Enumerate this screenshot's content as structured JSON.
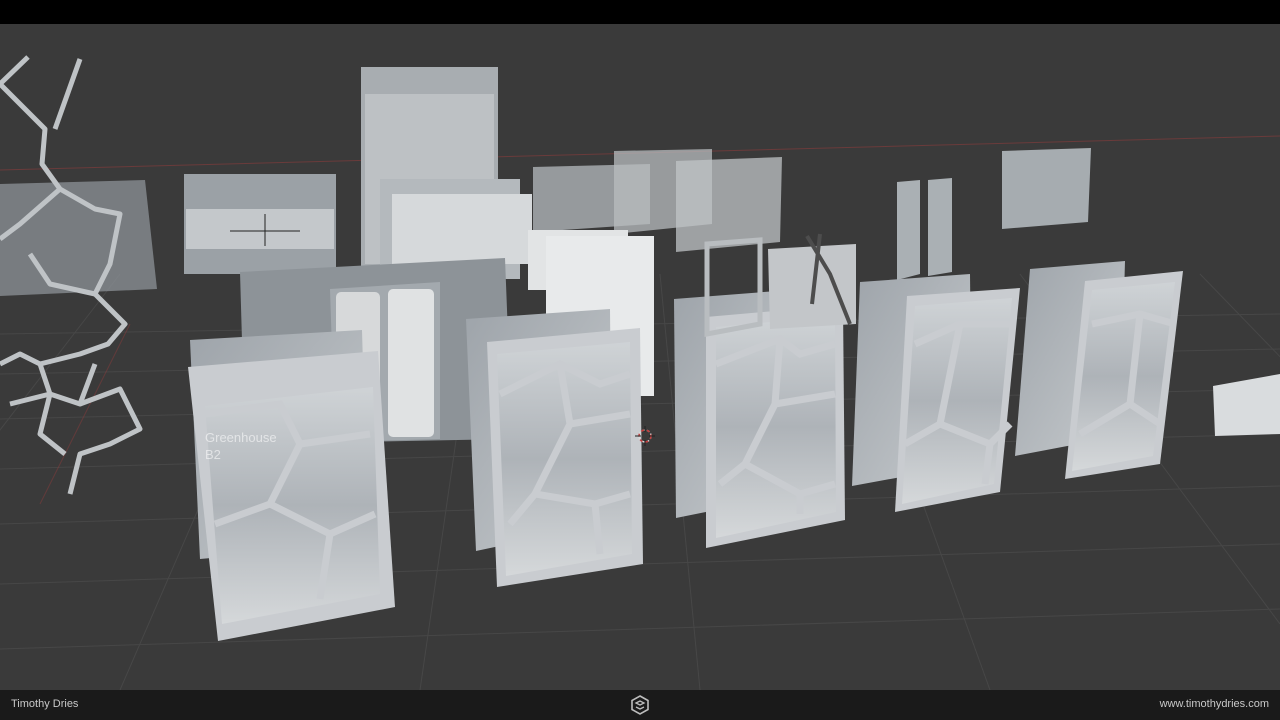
{
  "footer": {
    "author": "Timothy Dries",
    "website": "www.timothydries.com"
  },
  "viewport": {
    "label_line1": "Greenhouse",
    "label_line2": "B2"
  },
  "colors": {
    "background": "#3a3a3a",
    "grid": "#4a4a4a",
    "frame": "#c4c7cc",
    "glass": "#b9bec4",
    "x_axis": "#8a3c3c",
    "status_dot": "#8ccf3a"
  },
  "icons": {
    "logo": "cube-logo-icon",
    "cursor": "3d-cursor-icon"
  }
}
